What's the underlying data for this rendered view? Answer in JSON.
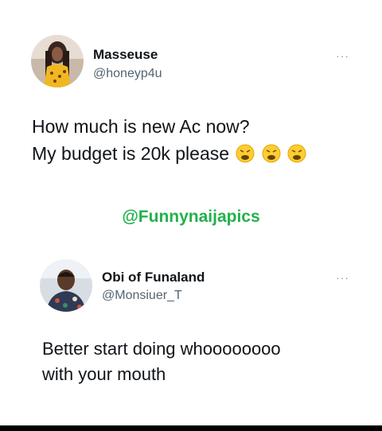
{
  "tweet1": {
    "name": "Masseuse",
    "handle": "@honeyp4u",
    "more_label": "···",
    "line1": "How much is new Ac now?",
    "line2": "My budget is 20k please",
    "emojis": [
      "weary-face-emoji",
      "weary-face-emoji",
      "weary-face-emoji"
    ]
  },
  "watermark": "@Funnynaijapics",
  "tweet2": {
    "name": "Obi of Funaland",
    "handle": "@Monsiuer_T",
    "more_label": "···",
    "line1": "Better start doing whoooooooo",
    "line2": "with your mouth"
  },
  "colors": {
    "watermark": "#22b14c",
    "handle": "#536471",
    "text": "#0f1419"
  }
}
